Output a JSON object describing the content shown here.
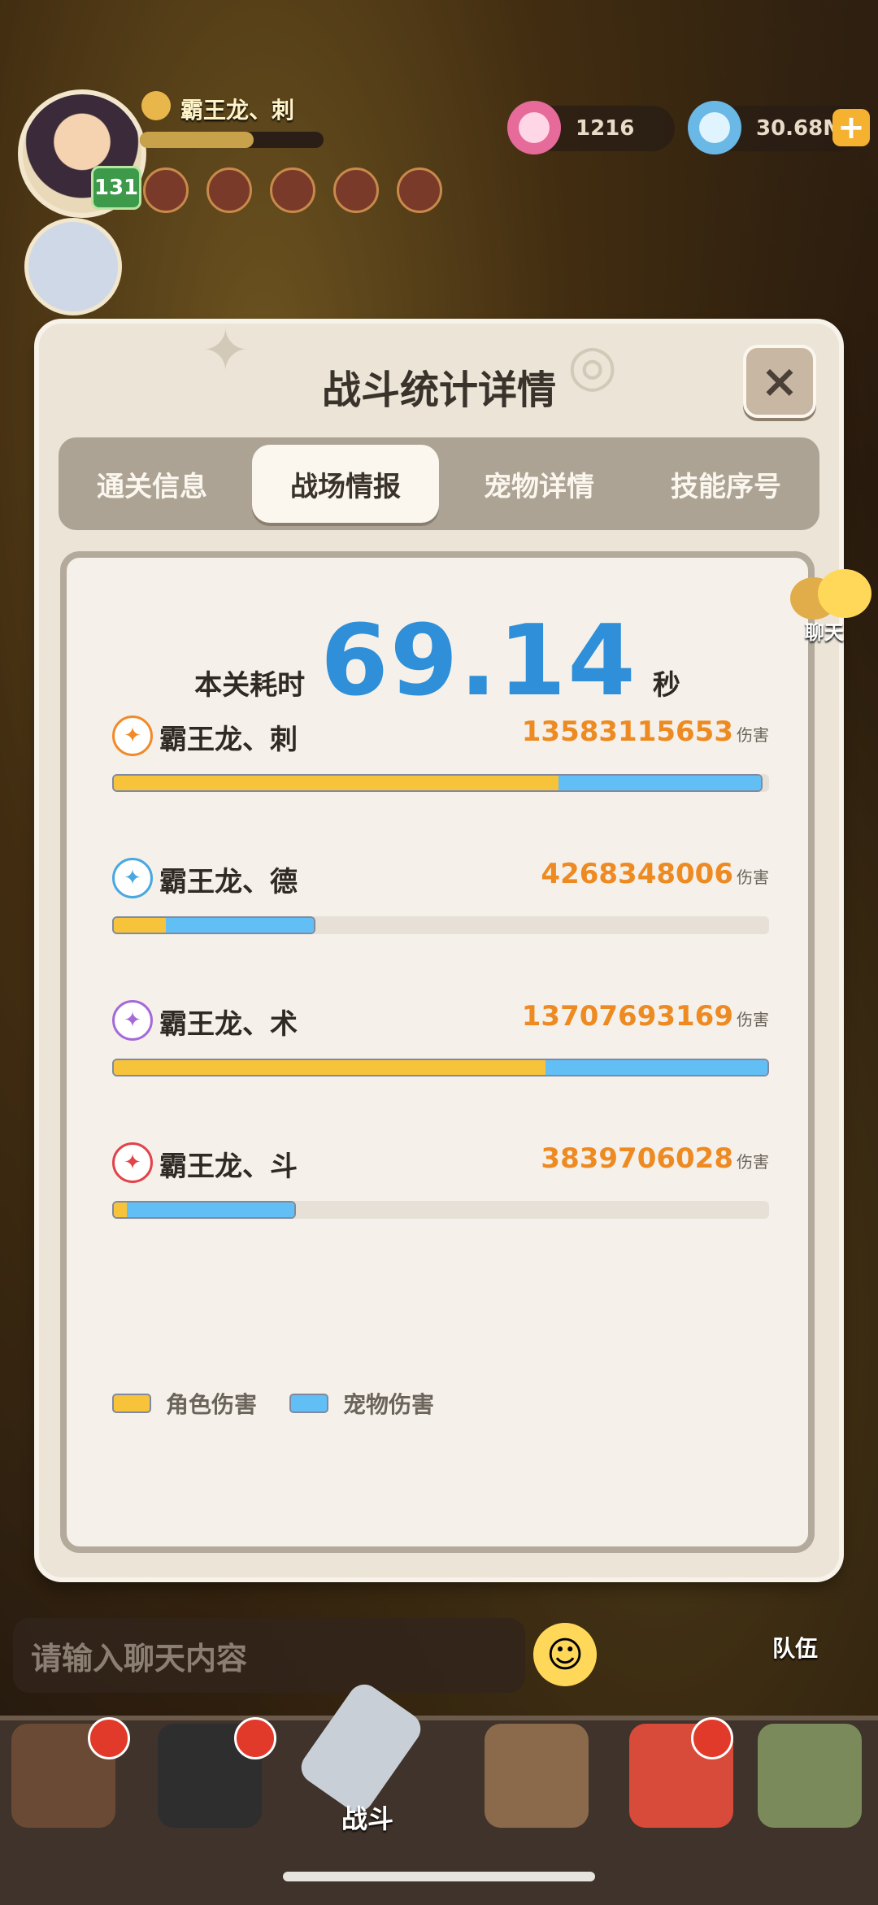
{
  "hud": {
    "player_name": "霸王龙、刺",
    "level": "131",
    "shells": "1216",
    "gems": "30.68M",
    "plus_label": "+"
  },
  "dialog": {
    "title": "战斗统计详情",
    "close_label": "×",
    "tabs": [
      {
        "label": "通关信息",
        "active": false
      },
      {
        "label": "战场情报",
        "active": true
      },
      {
        "label": "宠物详情",
        "active": false
      },
      {
        "label": "技能序号",
        "active": false
      }
    ],
    "time_label": "本关耗时",
    "time_value": "69.14",
    "time_unit": "秒",
    "damage_unit": "伤害",
    "stats": [
      {
        "name": "霸王龙、刺",
        "damage": "13583115653",
        "total_fraction": 0.99,
        "role_fraction": 0.68,
        "icon": "dagger-icon",
        "color": "#f28a2a"
      },
      {
        "name": "霸王龙、德",
        "damage": "4268348006",
        "total_fraction": 0.31,
        "role_fraction": 0.08,
        "icon": "wind-icon",
        "color": "#4aa8e0"
      },
      {
        "name": "霸王龙、术",
        "damage": "13707693169",
        "total_fraction": 1.0,
        "role_fraction": 0.66,
        "icon": "spiral-icon",
        "color": "#a56ad8"
      },
      {
        "name": "霸王龙、斗",
        "damage": "3839706028",
        "total_fraction": 0.28,
        "role_fraction": 0.02,
        "icon": "fist-icon",
        "color": "#e0444a"
      }
    ],
    "legend": {
      "role": "角色伤害",
      "pet": "宠物伤害",
      "role_color": "#f7c33a",
      "pet_color": "#62bff5"
    }
  },
  "side": {
    "chat_label": "聊天",
    "team_label": "队伍"
  },
  "bottom": {
    "chat_placeholder": "请输入聊天内容",
    "battle_label": "战斗"
  }
}
